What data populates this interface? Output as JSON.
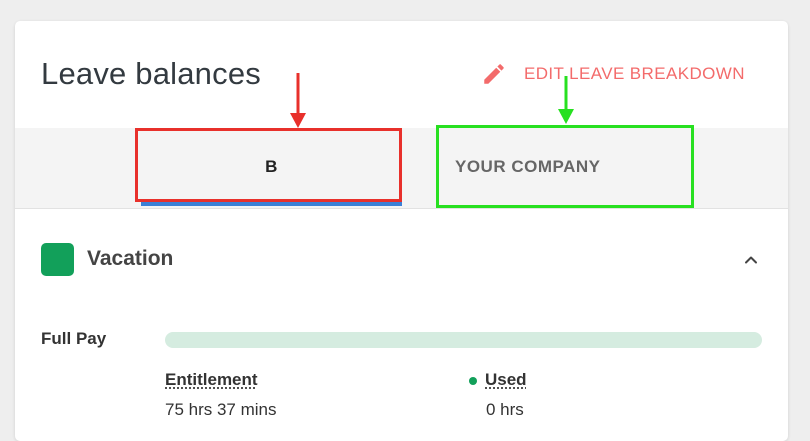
{
  "card": {
    "title": "Leave balances",
    "edit_label": "EDIT LEAVE BREAKDOWN",
    "edit_icon": "pencil-icon",
    "accent_color": "#f36b6b"
  },
  "tabs": [
    {
      "label": "B",
      "active": true
    },
    {
      "label": "YOUR COMPANY",
      "active": false
    }
  ],
  "leave_type": {
    "name": "Vacation",
    "color": "#12a05a",
    "expand_icon": "chevron-up-icon"
  },
  "pay": {
    "label": "Full Pay",
    "used_fraction": 0,
    "entitlement_label": "Entitlement",
    "entitlement_value": "75 hrs 37 mins",
    "used_label": "Used",
    "used_value": "0 hrs"
  },
  "annotations": {
    "red_box_color": "#e8302b",
    "green_box_color": "#27e020"
  }
}
